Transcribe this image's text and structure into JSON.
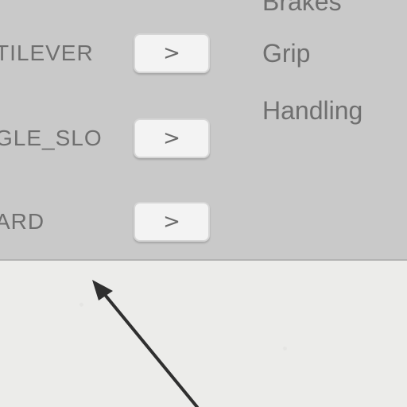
{
  "panel": {
    "top_cut_label": "Brakes",
    "rows": [
      {
        "label": "TILEVER",
        "button": ">"
      },
      {
        "label": "GLE_SLO",
        "button": ">"
      },
      {
        "label": "ARD",
        "button": ">"
      }
    ],
    "right_labels": [
      "Grip",
      "Handling"
    ]
  },
  "colors": {
    "panel_bg": "#c9c9c9",
    "button_bg": "#f3f3f3",
    "text": "#6f6f6f",
    "arrow": "#2f2f2f",
    "ground": "#ececea"
  },
  "icons": {
    "pointer": "arrow-pointer-icon"
  }
}
